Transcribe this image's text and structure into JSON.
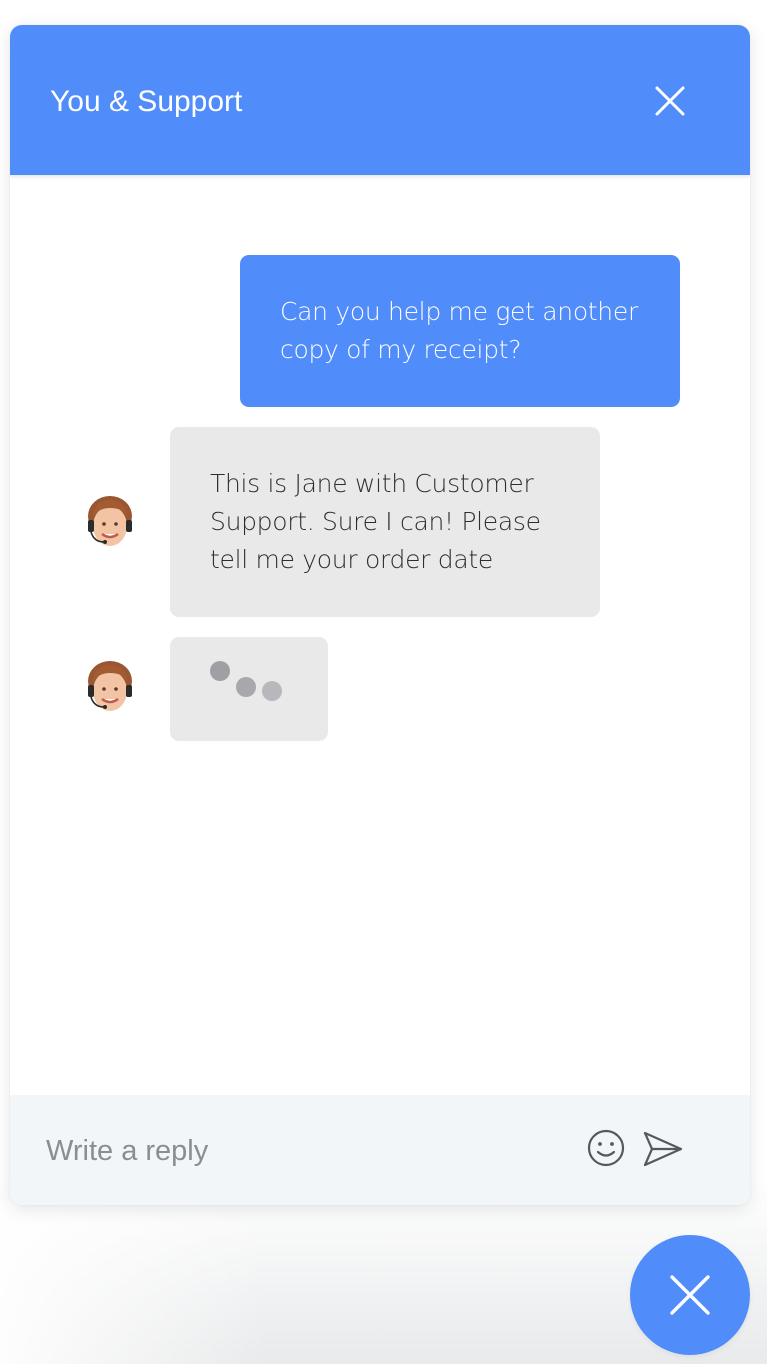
{
  "header": {
    "title": "You & Support",
    "close_icon": "close-icon"
  },
  "messages": [
    {
      "sender": "user",
      "text": "Can you help me get another copy of my receipt?"
    },
    {
      "sender": "agent",
      "text": "This is Jane with Customer Support. Sure I can! Please tell me your order date"
    },
    {
      "sender": "agent",
      "typing": true
    }
  ],
  "composer": {
    "placeholder": "Write a reply",
    "emoji_icon": "smiley-icon",
    "send_icon": "send-icon"
  },
  "launcher": {
    "icon": "close-icon"
  },
  "colors": {
    "accent": "#518cfb",
    "agent_bubble": "#e9e9e9",
    "composer_background": "#f3f6f9",
    "placeholder_text": "#8a8d91"
  }
}
